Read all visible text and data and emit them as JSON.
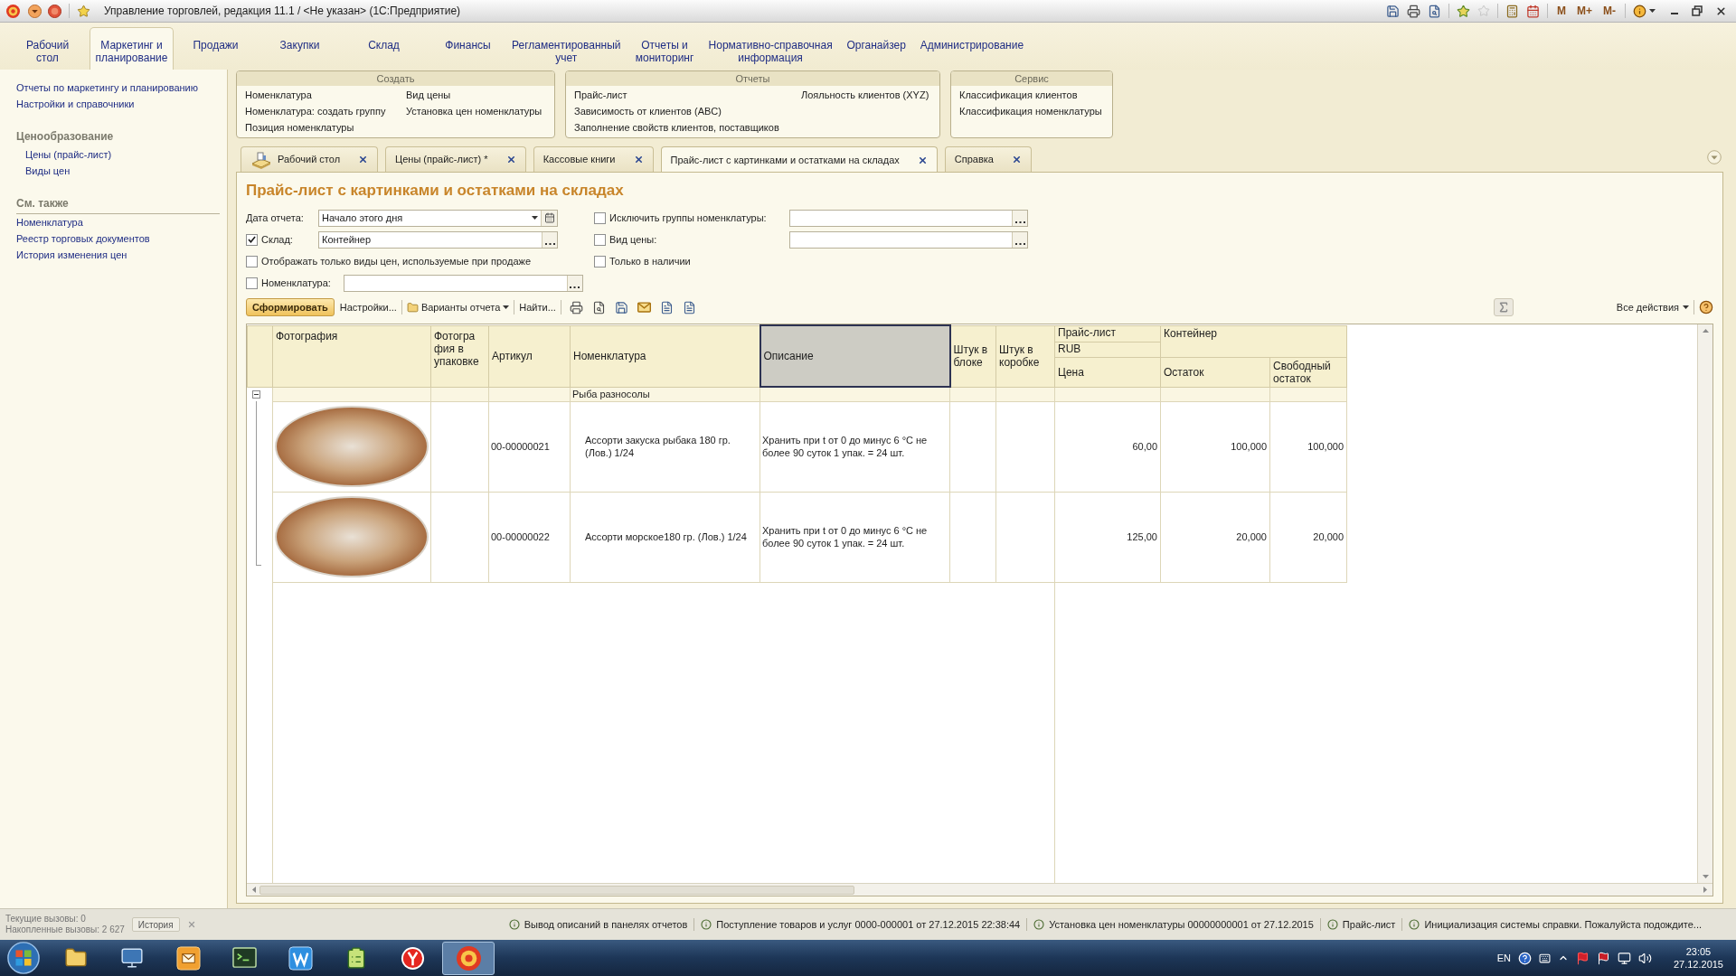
{
  "window": {
    "title": "Управление торговлей, редакция 11.1 / <Не указан> (1С:Предприятие)",
    "memory_buttons": [
      "M",
      "M+",
      "M-"
    ]
  },
  "sections": [
    {
      "label": "Рабочий\nстол",
      "selected": false
    },
    {
      "label": "Маркетинг и\nпланирование",
      "selected": true
    },
    {
      "label": "Продажи",
      "selected": false
    },
    {
      "label": "Закупки",
      "selected": false
    },
    {
      "label": "Склад",
      "selected": false
    },
    {
      "label": "Финансы",
      "selected": false
    },
    {
      "label": "Регламентированный\nучет",
      "selected": false
    },
    {
      "label": "Отчеты и\nмониторинг",
      "selected": false
    },
    {
      "label": "Нормативно-справочная\nинформация",
      "selected": false
    },
    {
      "label": "Органайзер",
      "selected": false
    },
    {
      "label": "Администрирование",
      "selected": false
    }
  ],
  "sidebar": {
    "links": [
      "Отчеты по маркетингу и планированию",
      "Настройки и справочники"
    ],
    "groups": [
      {
        "kind": "section",
        "title": "Ценообразование",
        "items": [
          "Цены (прайс-лист)",
          "Виды цен"
        ]
      },
      {
        "kind": "see_also",
        "title": "См. также",
        "items": [
          "Номенклатура",
          "Реестр торговых документов",
          "История изменения цен"
        ]
      }
    ]
  },
  "command_panel": [
    {
      "title": "Создать",
      "columns": [
        [
          "Номенклатура",
          "Номенклатура: создать группу",
          "Позиция номенклатуры"
        ],
        [
          "Вид цены",
          "Установка цен номенклатуры"
        ]
      ]
    },
    {
      "title": "Отчеты",
      "columns": [
        [
          "Прайс-лист",
          "Зависимость от клиентов (ABC)",
          "Заполнение свойств клиентов, поставщиков"
        ],
        [
          "Лояльность клиентов (XYZ)"
        ]
      ]
    },
    {
      "title": "Сервис",
      "columns": [
        [
          "Классификация клиентов",
          "Классификация номенклатуры"
        ]
      ]
    }
  ],
  "open_tabs": [
    {
      "label": "Рабочий стол",
      "kind": "desktop",
      "selected": false
    },
    {
      "label": "Цены (прайс-лист) *",
      "kind": "form",
      "selected": false
    },
    {
      "label": "Кассовые книги",
      "kind": "form",
      "selected": false
    },
    {
      "label": "Прайс-лист с картинками и остатками на складах",
      "kind": "form",
      "selected": true
    },
    {
      "label": "Справка",
      "kind": "form",
      "selected": false
    }
  ],
  "report": {
    "title": "Прайс-лист с картинками и остатками на складах",
    "filters_left": [
      {
        "kind": "date",
        "label": "Дата отчета:",
        "value": "Начало этого дня"
      },
      {
        "kind": "checkfield",
        "label": "Склад:",
        "checked": true,
        "value": "Контейнер"
      },
      {
        "kind": "checkbox",
        "label": "Отображать только виды цен, используемые при продаже",
        "checked": false
      },
      {
        "kind": "checkfield",
        "label": "Номенклатура:",
        "checked": false
      }
    ],
    "filters_right": [
      {
        "kind": "checkfield",
        "label": "Исключить группы номенклатуры:",
        "checked": false
      },
      {
        "kind": "checkfield",
        "label": "Вид цены:",
        "checked": false
      },
      {
        "kind": "checkbox",
        "label": "Только в наличии",
        "checked": false
      }
    ],
    "toolbar": {
      "generate": "Сформировать",
      "settings": "Настройки...",
      "variants": "Варианты отчета",
      "find": "Найти...",
      "all_actions": "Все действия"
    },
    "table": {
      "columns": [
        {
          "label": "Фотография",
          "selected": false
        },
        {
          "label": "Фотогра\nфия в\nупаковке",
          "selected": false
        },
        {
          "label": "Артикул",
          "selected": false
        },
        {
          "label": "Номенклатура",
          "selected": false
        },
        {
          "label": "Описание",
          "selected": true
        },
        {
          "label": "Штук в блоке",
          "selected": false
        },
        {
          "label": "Штук в коробке",
          "selected": false
        }
      ],
      "price_group": {
        "title": "Прайс-лист",
        "currency": "RUB",
        "columns": [
          "Цена"
        ]
      },
      "stock_group": {
        "title": "Контейнер",
        "columns": [
          "Остаток",
          "Свободный остаток"
        ]
      },
      "groups": [
        {
          "name": "Рыба разносолы",
          "expanded": true,
          "rows": [
            {
              "article": "00-00000021",
              "name": "Ассорти закуска рыбака 180 гр. (Лов.) 1/24",
              "description": "Хранить при t от 0 до минус 6 °С не более 90 суток 1 упак. = 24 шт.",
              "price": "60,00",
              "stock": "100,000",
              "free_stock": "100,000"
            },
            {
              "article": "00-00000022",
              "name": "Ассорти морское180 гр. (Лов.) 1/24",
              "description": "Хранить при t от 0 до минус 6 °С не более 90 суток 1 упак. = 24 шт.",
              "price": "125,00",
              "stock": "20,000",
              "free_stock": "20,000"
            }
          ]
        }
      ]
    }
  },
  "status_bar": {
    "calls": [
      "Текущие вызовы: 0",
      "Накопленные вызовы: 2 627"
    ],
    "history": "История",
    "messages": [
      "Вывод описаний в панелях отчетов",
      "Поступление товаров и услуг 0000-000001 от 27.12.2015 22:38:44",
      "Установка цен номенклатуры 00000000001 от 27.12.2015",
      "Прайс-лист",
      "Инициализация системы справки. Пожалуйста подождите..."
    ]
  },
  "taskbar": {
    "language": "EN",
    "time": "23:05",
    "date": "27.12.2015"
  }
}
